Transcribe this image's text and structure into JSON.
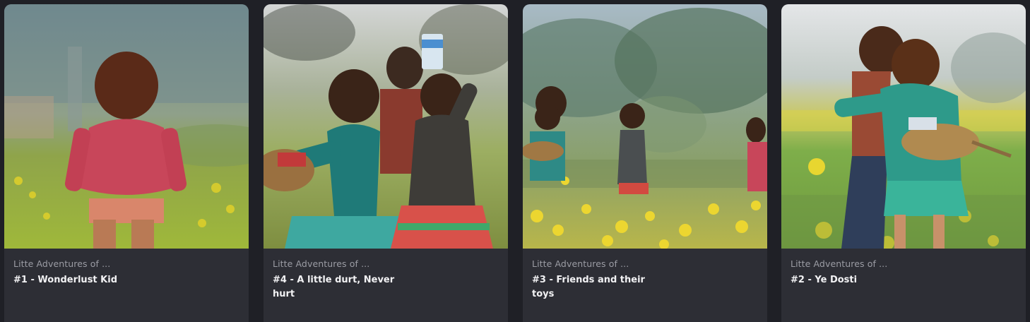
{
  "cards": [
    {
      "collection": "Litte Adventures of ...",
      "title": "#1 - Wonderlust Kid",
      "image": "girl-walking-in-mustard-field"
    },
    {
      "collection": "Litte Adventures of ...",
      "title": "#4 - A little durt, Never hurt",
      "image": "three-children-with-basket"
    },
    {
      "collection": "Litte Adventures of ...",
      "title": "#3 - Friends and their toys",
      "image": "children-walking-in-field"
    },
    {
      "collection": "Litte Adventures of ...",
      "title": "#2 - Ye Dosti",
      "image": "two-girls-hugging-in-field"
    }
  ],
  "colors": {
    "background": "#1f2026",
    "card": "#2d2e35",
    "muted_text": "#9b9ca4",
    "title_text": "#f2f2f4"
  }
}
